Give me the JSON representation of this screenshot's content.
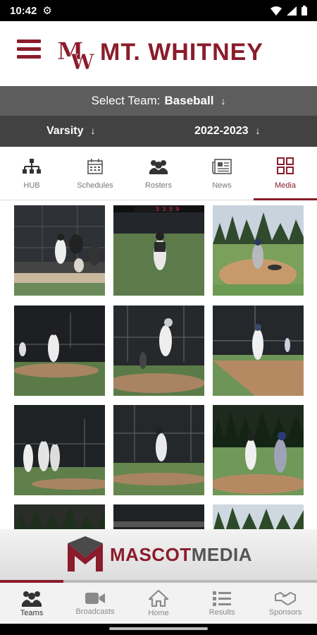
{
  "status_bar": {
    "time": "10:42"
  },
  "header": {
    "title": "MT. WHITNEY"
  },
  "team_selector": {
    "label": "Select Team:",
    "value": "Baseball"
  },
  "filters": {
    "level": "Varsity",
    "season": "2022-2023"
  },
  "tabs": [
    {
      "label": "HUB",
      "icon": "hierarchy-icon"
    },
    {
      "label": "Schedules",
      "icon": "calendar-icon"
    },
    {
      "label": "Rosters",
      "icon": "group-icon"
    },
    {
      "label": "News",
      "icon": "newspaper-icon"
    },
    {
      "label": "Media",
      "icon": "grid-icon",
      "active": true
    }
  ],
  "scoreboard_text": "3 3 5 0",
  "sponsor": {
    "part1": "MASCOT",
    "part2": "MEDIA"
  },
  "bottom_nav": [
    {
      "label": "Teams",
      "icon": "teams-icon",
      "active": true
    },
    {
      "label": "Broadcasts",
      "icon": "video-camera-icon"
    },
    {
      "label": "Home",
      "icon": "home-icon"
    },
    {
      "label": "Results",
      "icon": "list-icon"
    },
    {
      "label": "Sponsors",
      "icon": "handshake-icon"
    }
  ],
  "colors": {
    "brand": "#8a1c2b",
    "team_bar": "#5d5d5d",
    "filter_bar": "#424242"
  }
}
